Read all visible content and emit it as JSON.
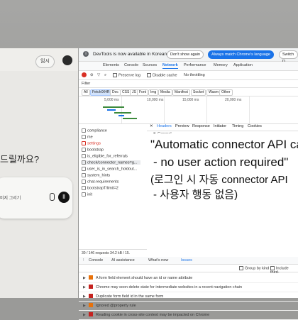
{
  "chat": {
    "temp_button": "임시",
    "prompt_text": "드릴까요?",
    "draw_button": "미지 그리기"
  },
  "devtools": {
    "banner": {
      "info_glyph": "i",
      "message": "DevTools is now available in Korean",
      "dont_show": "Don't show again",
      "match_lang": "Always match Chrome's language",
      "switch": "Switch D"
    },
    "tabs": [
      "Elements",
      "Console",
      "Sources",
      "Network",
      "Performance",
      "Memory",
      "Application"
    ],
    "toolbar": {
      "preserve_log": "Preserve log",
      "disable_cache": "Disable cache",
      "throttle": "No throttling"
    },
    "filter_label": "Filter",
    "type_filters": [
      "All",
      "Fetch/XHR",
      "Doc",
      "CSS",
      "JS",
      "Font",
      "Img",
      "Media",
      "Manifest",
      "Socket",
      "Wasm",
      "Other"
    ],
    "timeline_ticks": [
      "5,000 ms",
      "10,000 ms",
      "15,000 ms",
      "20,000 ms"
    ],
    "requests": [
      {
        "name": "compliance",
        "err": false
      },
      {
        "name": "me",
        "err": false
      },
      {
        "name": "settings",
        "err": true
      },
      {
        "name": "bootstrap",
        "err": false
      },
      {
        "name": "is_eligible_for_referrals",
        "err": false
      },
      {
        "name": "check/connector_names=g...",
        "err": false
      },
      {
        "name": "user_is_in_search_holdout...",
        "err": false
      },
      {
        "name": "system_hints",
        "err": false
      },
      {
        "name": "chat-requirements",
        "err": false
      },
      {
        "name": "bootstrapT/limit=2",
        "err": false
      },
      {
        "name": "init",
        "err": false
      }
    ],
    "detail_tabs": [
      "Headers",
      "Preview",
      "Response",
      "Initiator",
      "Timing",
      "Cookies"
    ],
    "general_label": "▼ General",
    "status_text": "30 / 146 requests  34.2 kB / 15.",
    "drawer_tabs": [
      "Console",
      "AI assistance",
      "What's new",
      "Issues"
    ],
    "group_by_kind": "Group by kind",
    "include_third": "Include third-",
    "issues": [
      {
        "text": "A form field element should have an id or name attribute",
        "severity": "warning"
      },
      {
        "text": "Chrome may soon delete state for intermediate websites in a recent navigation chain",
        "severity": "error"
      },
      {
        "text": "Duplicate form field id in the same form",
        "severity": "error"
      },
      {
        "text": "Ignored @property rule",
        "severity": "warning"
      },
      {
        "text": "Reading cookie in cross-site context may be impacted on Chrome",
        "severity": "error"
      }
    ]
  },
  "caption": {
    "line1": "\"Automatic connector API ca",
    "line2": "- no user action required\"",
    "line3": "(로그인 시 자동 connector API",
    "line4": "- 사용자 행동 없음)"
  },
  "colors": {
    "accent": "#1a73e8",
    "record": "#d93025",
    "warning": "#e8710a",
    "error": "#c5221f"
  }
}
